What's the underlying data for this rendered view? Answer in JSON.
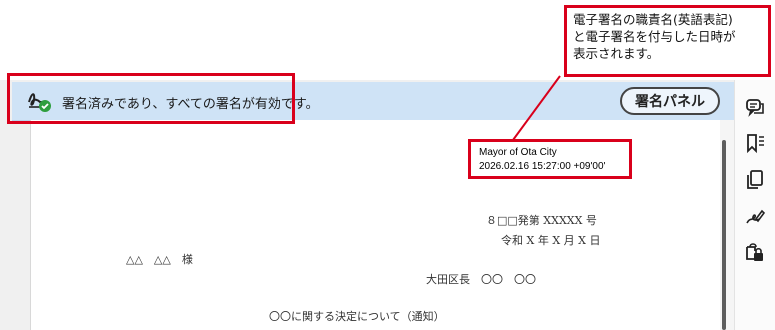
{
  "callout": {
    "lines": [
      "電子署名の職責名(英語表記)",
      "と電子署名を付与した日時が",
      "表示されます。"
    ]
  },
  "signature_bar": {
    "message": "署名済みであり、すべての署名が有効です。",
    "panel_button": "署名パネル"
  },
  "signature_info": {
    "title": "Mayor of Ota City",
    "datetime": "2026.02.16 15:27:00 +09'00'"
  },
  "document": {
    "doc_number": "８□□発第 XXXXX 号",
    "date": "令和 X 年 X 月 X 日",
    "recipient": "△△　△△　様",
    "sender": "大田区長　〇〇　〇〇",
    "subject": "〇〇に関する決定について（通知）"
  },
  "right_rail": {
    "icons": [
      "comment-icon",
      "bookmark-list-icon",
      "pages-icon",
      "fill-sign-icon",
      "protect-icon"
    ]
  },
  "colors": {
    "highlight_red": "#d9001b",
    "signature_bar_bg": "#cfe3f6",
    "valid_check_green": "#2e9e3e"
  }
}
